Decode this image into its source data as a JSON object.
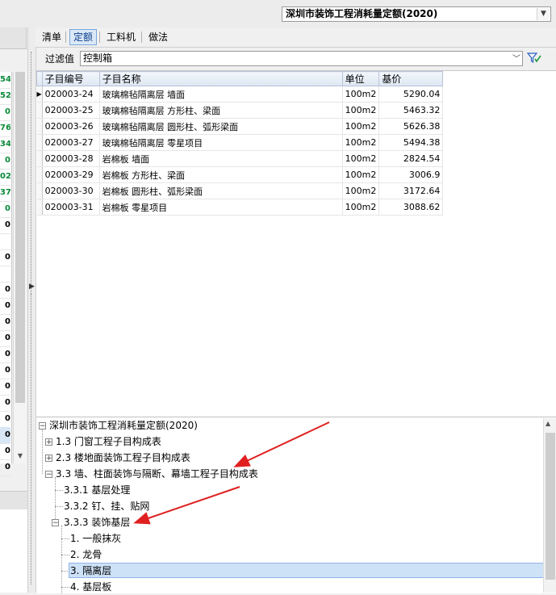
{
  "header": {
    "quota_name": "深圳市装饰工程消耗量定额(2020)"
  },
  "left_strip": {
    "values": [
      "54",
      "52",
      "0",
      "76",
      "34",
      "0",
      "02",
      "37",
      "0",
      "0",
      "",
      "0",
      "",
      "0",
      "0",
      "0",
      "0",
      "0",
      "0",
      "0",
      "0",
      "0",
      "0",
      "0",
      "0"
    ],
    "green_count": 9
  },
  "tabs": [
    {
      "label": "清单"
    },
    {
      "label": "定额"
    },
    {
      "label": "工料机"
    },
    {
      "label": "做法"
    }
  ],
  "filter": {
    "label": "过滤值",
    "value": "控制箱"
  },
  "grid": {
    "columns": [
      "子目编号",
      "子目名称",
      "单位",
      "基价"
    ],
    "rows": [
      {
        "code": "020003-24",
        "name": "玻璃棉毡隔离层 墙面",
        "unit": "100m2",
        "price": "5290.04"
      },
      {
        "code": "020003-25",
        "name": "玻璃棉毡隔离层 方形柱、梁面",
        "unit": "100m2",
        "price": "5463.32"
      },
      {
        "code": "020003-26",
        "name": "玻璃棉毡隔离层 圆形柱、弧形梁面",
        "unit": "100m2",
        "price": "5626.38"
      },
      {
        "code": "020003-27",
        "name": "玻璃棉毡隔离层 零星项目",
        "unit": "100m2",
        "price": "5494.38"
      },
      {
        "code": "020003-28",
        "name": "岩棉板 墙面",
        "unit": "100m2",
        "price": "2824.54"
      },
      {
        "code": "020003-29",
        "name": "岩棉板 方形柱、梁面",
        "unit": "100m2",
        "price": "3006.9"
      },
      {
        "code": "020003-30",
        "name": "岩棉板 圆形柱、弧形梁面",
        "unit": "100m2",
        "price": "3172.64"
      },
      {
        "code": "020003-31",
        "name": "岩棉板 零星项目",
        "unit": "100m2",
        "price": "3088.62"
      }
    ]
  },
  "tree": {
    "root": "深圳市装饰工程消耗量定额(2020)",
    "n1": "1.3 门窗工程子目构成表",
    "n2": "2.3 楼地面装饰工程子目构成表",
    "n3": "3.3 墙、柱面装饰与隔断、幕墙工程子目构成表",
    "n331": "3.3.1 基层处理",
    "n332": "3.3.2 钉、挂、贴网",
    "n333": "3.3.3 装饰基层",
    "l1": "1. 一般抹灰",
    "l2": "2. 龙骨",
    "l3": "3. 隔离层",
    "l4": "4. 基层板"
  }
}
